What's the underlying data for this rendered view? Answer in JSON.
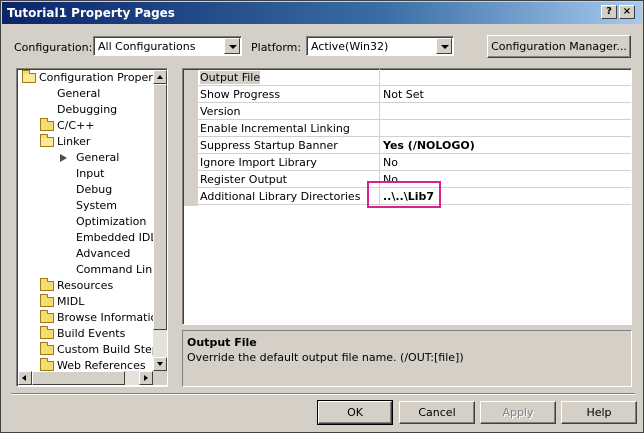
{
  "window": {
    "title": "Tutorial1 Property Pages",
    "help_glyph": "?",
    "close_glyph": "×"
  },
  "toolbar": {
    "configuration_label": "Configuration:",
    "configuration_value": "All Configurations",
    "platform_label": "Platform:",
    "platform_value": "Active(Win32)",
    "config_manager_label": "Configuration Manager..."
  },
  "tree": {
    "items": [
      {
        "label": "Configuration Properties",
        "icon": "folder-open-icon",
        "level": 0
      },
      {
        "label": "General",
        "icon": "none",
        "level": 1
      },
      {
        "label": "Debugging",
        "icon": "none",
        "level": 1
      },
      {
        "label": "C/C++",
        "icon": "folder-icon",
        "level": 1
      },
      {
        "label": "Linker",
        "icon": "folder-open-icon",
        "level": 1
      },
      {
        "label": "General",
        "icon": "pointer-icon",
        "level": 2,
        "selected": true
      },
      {
        "label": "Input",
        "icon": "none",
        "level": 2
      },
      {
        "label": "Debug",
        "icon": "none",
        "level": 2
      },
      {
        "label": "System",
        "icon": "none",
        "level": 2
      },
      {
        "label": "Optimization",
        "icon": "none",
        "level": 2
      },
      {
        "label": "Embedded IDL",
        "icon": "none",
        "level": 2
      },
      {
        "label": "Advanced",
        "icon": "none",
        "level": 2
      },
      {
        "label": "Command Line",
        "icon": "none",
        "level": 2
      },
      {
        "label": "Resources",
        "icon": "folder-icon",
        "level": 1
      },
      {
        "label": "MIDL",
        "icon": "folder-icon",
        "level": 1
      },
      {
        "label": "Browse Information",
        "icon": "folder-icon",
        "level": 1
      },
      {
        "label": "Build Events",
        "icon": "folder-icon",
        "level": 1
      },
      {
        "label": "Custom Build Step",
        "icon": "folder-icon",
        "level": 1
      },
      {
        "label": "Web References",
        "icon": "folder-icon",
        "level": 1
      }
    ]
  },
  "properties": {
    "rows": [
      {
        "name": "Output File",
        "value": "",
        "bold": false,
        "selected": true
      },
      {
        "name": "Show Progress",
        "value": "Not Set",
        "bold": false
      },
      {
        "name": "Version",
        "value": "",
        "bold": false
      },
      {
        "name": "Enable Incremental Linking",
        "value": "",
        "bold": false
      },
      {
        "name": "Suppress Startup Banner",
        "value": "Yes (/NOLOGO)",
        "bold": true
      },
      {
        "name": "Ignore Import Library",
        "value": "No",
        "bold": false
      },
      {
        "name": "Register Output",
        "value": "No",
        "bold": false
      },
      {
        "name": "Additional Library Directories",
        "value": "..\\..\\Lib7",
        "bold": true
      }
    ],
    "highlight_color": "#d6218f"
  },
  "description": {
    "title": "Output File",
    "text": "Override the default output file name.     (/OUT:[file])"
  },
  "buttons": {
    "ok": "OK",
    "cancel": "Cancel",
    "apply": "Apply",
    "help": "Help"
  }
}
